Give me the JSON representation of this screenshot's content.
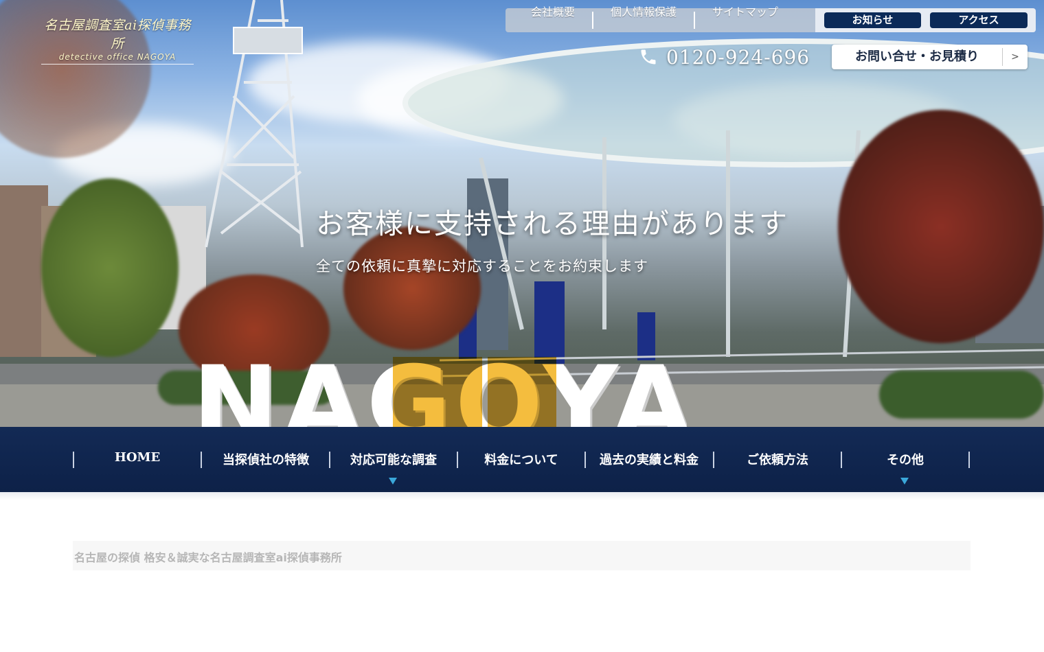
{
  "brand": {
    "name": "名古屋調査室ai探偵事務所",
    "subtitle": "detective office NAGOYA"
  },
  "utility_nav": {
    "links": [
      "会社概要",
      "個人情報保護",
      "サイトマップ"
    ],
    "pills": [
      "お知らせ",
      "アクセス"
    ]
  },
  "contact": {
    "phone": "0120-924-696",
    "cta_label": "お問い合せ・お見積り",
    "cta_arrow": ">"
  },
  "hero": {
    "headline": "お客様に支持される理由があります",
    "subline": "全ての依頼に真摯に対応することをお約束します",
    "sign_text": "NAGOYA"
  },
  "main_nav": {
    "items": [
      {
        "label": "HOME",
        "has_dropdown": false
      },
      {
        "label": "当探偵社の特徴",
        "has_dropdown": false
      },
      {
        "label": "対応可能な調査",
        "has_dropdown": true
      },
      {
        "label": "料金について",
        "has_dropdown": false
      },
      {
        "label": "過去の実績と料金",
        "has_dropdown": false
      },
      {
        "label": "ご依頼方法",
        "has_dropdown": false
      },
      {
        "label": "その他",
        "has_dropdown": true
      }
    ]
  },
  "breadcrumb": {
    "text": "名古屋の探偵 格安＆誠実な名古屋調査室ai探偵事務所"
  },
  "colors": {
    "nav_bg": "#132a55",
    "pill_bg": "#0b2a58",
    "caret": "#3aa7d9",
    "sign_yellow": "#f2b21c",
    "sign_white": "#ffffff"
  }
}
